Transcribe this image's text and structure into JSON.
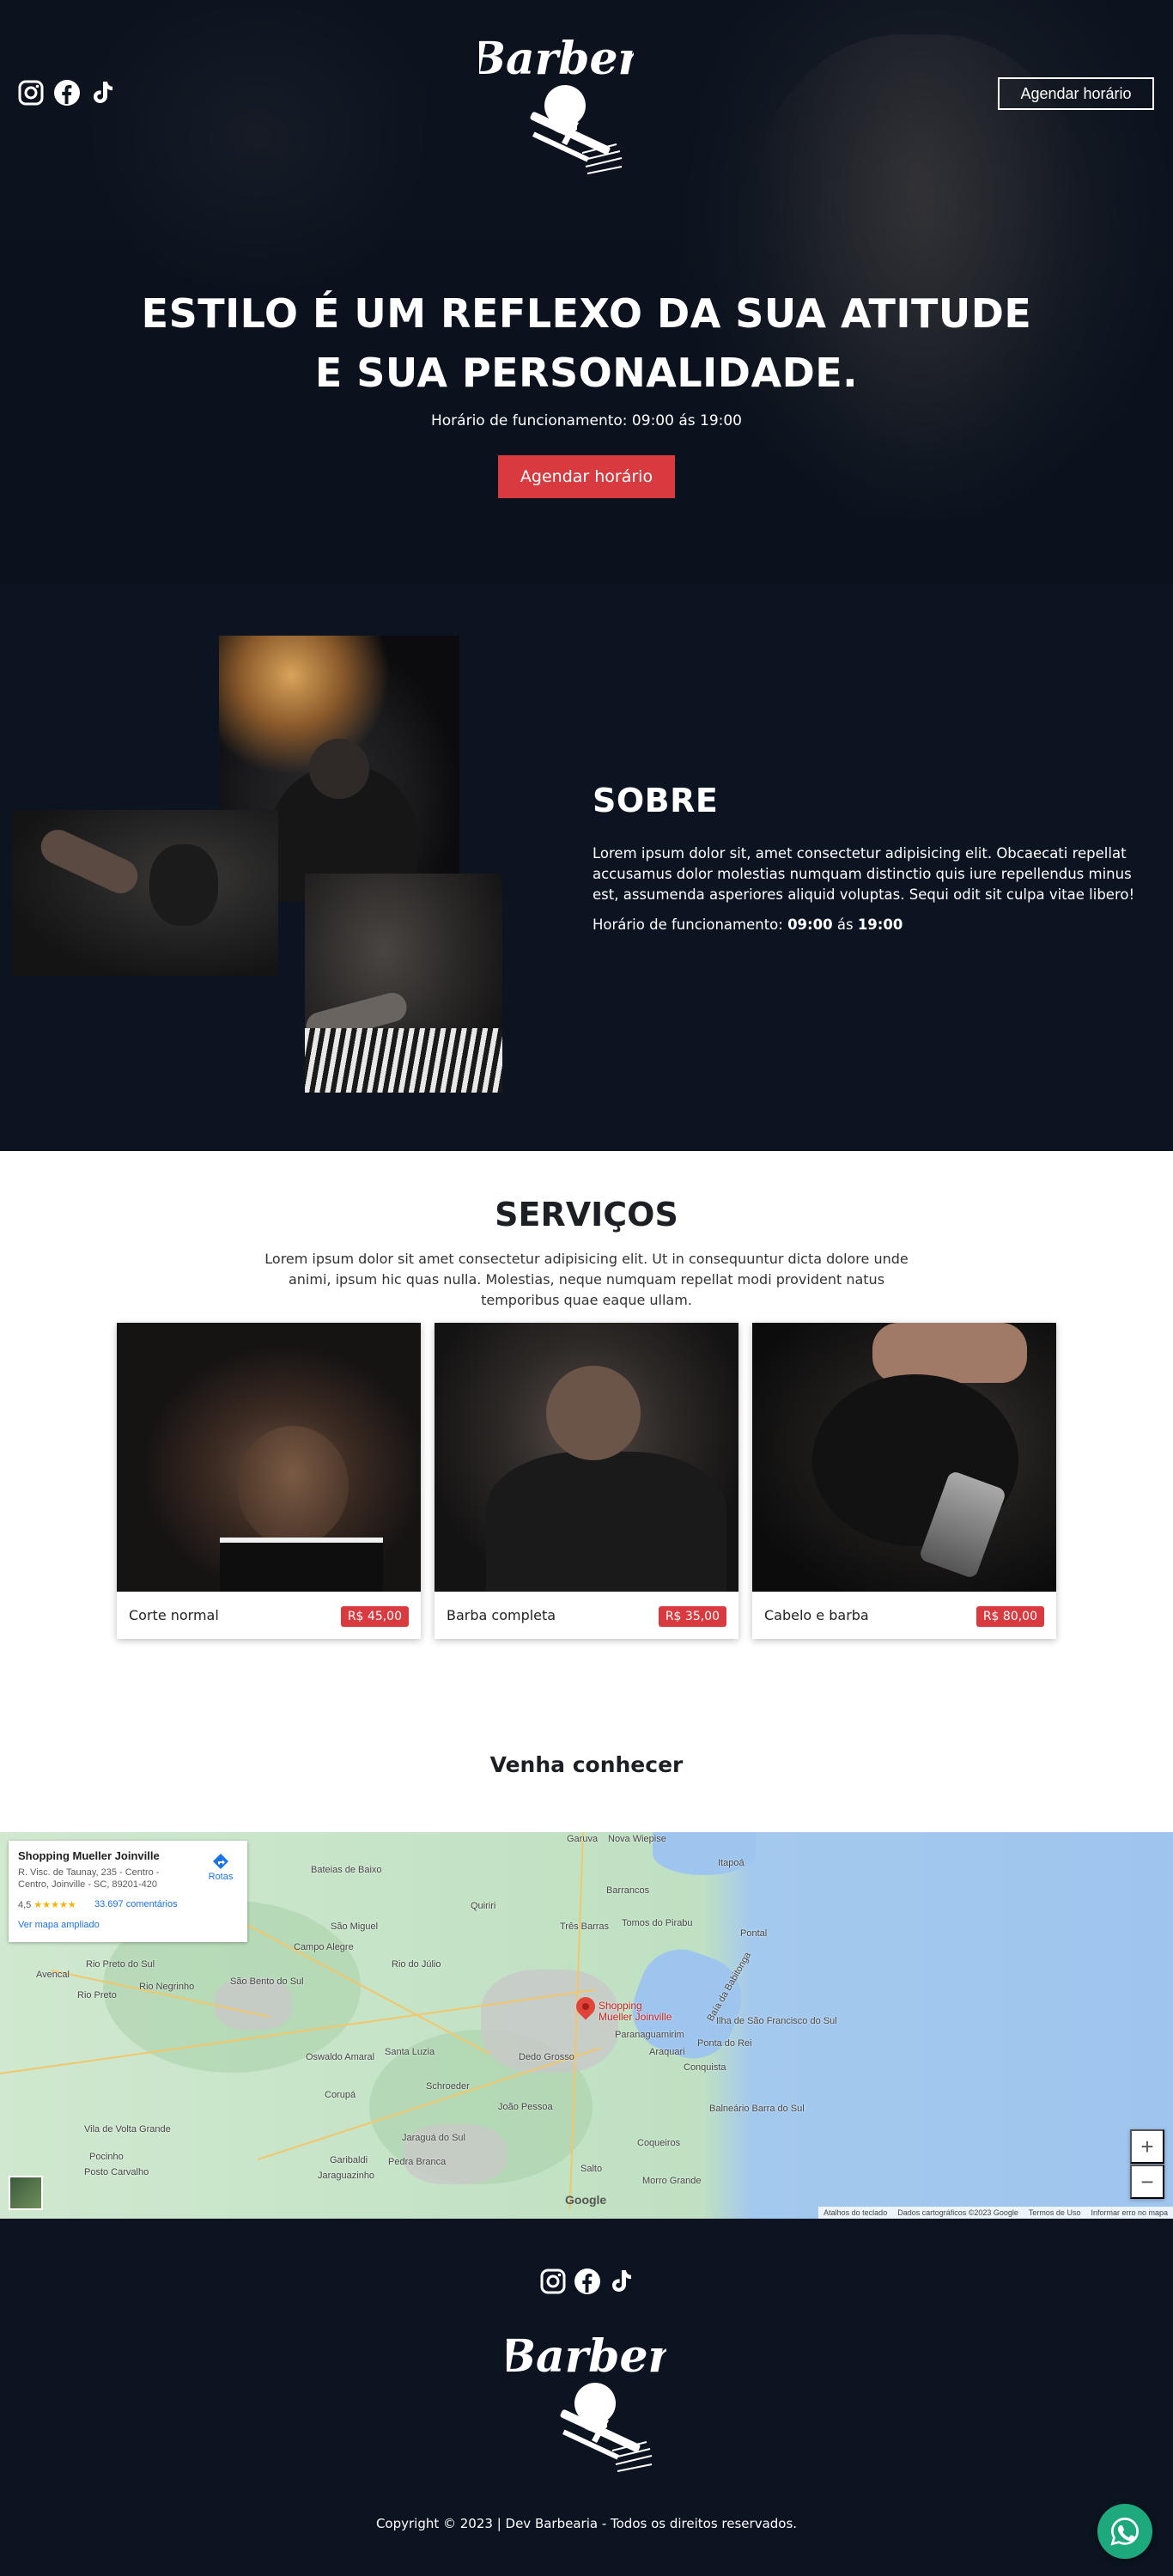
{
  "header": {
    "logo_text": "Barber",
    "cta_label": "Agendar horário",
    "social_icons": [
      "instagram-icon",
      "facebook-icon",
      "tiktok-icon"
    ]
  },
  "hero": {
    "title_line1": "ESTILO É UM REFLEXO DA SUA ATITUDE",
    "title_line2": "E SUA PERSONALIDADE.",
    "hours": "Horário de funcionamento: 09:00 ás 19:00",
    "cta_label": "Agendar horário"
  },
  "sobre": {
    "title": "SOBRE",
    "text": "Lorem ipsum dolor sit, amet consectetur adipisicing elit. Obcaecati repellat accusamus dolor molestias numquam distinctio quis iure repellendus minus est, assumenda asperiores aliquid voluptas. Sequi odit sit culpa vitae libero!",
    "hours_label": "Horário de funcionamento:",
    "hours_open": "09:00",
    "hours_sep": "ás",
    "hours_close": "19:00"
  },
  "servicos": {
    "title": "SERVIÇOS",
    "description": "Lorem ipsum dolor sit amet consectetur adipisicing elit. Ut in consequuntur dicta dolore unde animi, ipsum hic quas nulla. Molestias, neque numquam repellat modi provident natus temporibus quae eaque ullam.",
    "cards": [
      {
        "name": "Corte normal",
        "price": "R$ 45,00"
      },
      {
        "name": "Barba completa",
        "price": "R$ 35,00"
      },
      {
        "name": "Cabelo e barba",
        "price": "R$ 80,00"
      }
    ]
  },
  "location": {
    "title": "Venha conhecer",
    "map": {
      "place_name": "Shopping Mueller Joinville",
      "address": "R. Visc. de Taunay, 235 - Centro - Centro, Joinville - SC, 89201-420",
      "rating": "4,5",
      "stars": "★★★★★",
      "reviews": "33.697 comentários",
      "view_larger": "Ver mapa ampliado",
      "directions": "Rotas",
      "pin_label_1": "Shopping",
      "pin_label_2": "Mueller Joinville",
      "places": [
        "Garuva",
        "Nova Wiepise",
        "Bateias de Baixo",
        "Itapoá",
        "Barrancos",
        "Quiriri",
        "São Miguel",
        "Três Barras",
        "Tomos do Pirabu",
        "Pontal",
        "Campo Alegre",
        "Rio Preto do Sul",
        "Avencal",
        "Rio Negrinho",
        "Rio Preto",
        "São Bento do Sul",
        "Rio do Júlio",
        "Ilha de São Francisco do Sul",
        "Ponta do Rei",
        "Paranaguamirim",
        "Araquari",
        "Conquista",
        "Dedo Grosso",
        "Santa Luzia",
        "Oswaldo Amaral",
        "Corupá",
        "Schroeder",
        "João Pessoa",
        "Balneário Barra do Sul",
        "Coqueiros",
        "Vila de Volta Grande",
        "Pocinho",
        "Posto Carvalho",
        "Garibaldi",
        "Jaraguazinho",
        "Pedra Branca",
        "Jaraguá do Sul",
        "Salto",
        "Morro Grande",
        "Baía da Babitonga"
      ],
      "attribution": [
        "Atalhos do teclado",
        "Dados cartográficos ©2023 Google",
        "Termos de Uso",
        "Informar erro no mapa"
      ],
      "google_label": "Google",
      "zoom_in": "+",
      "zoom_out": "−"
    }
  },
  "footer": {
    "copyright": "Copyright © 2023 | Dev Barbearia - Todos os direitos reservados."
  },
  "colors": {
    "navy": "#0b1420",
    "accent_red": "#d83a3f",
    "whatsapp_green": "#1ea97c"
  }
}
